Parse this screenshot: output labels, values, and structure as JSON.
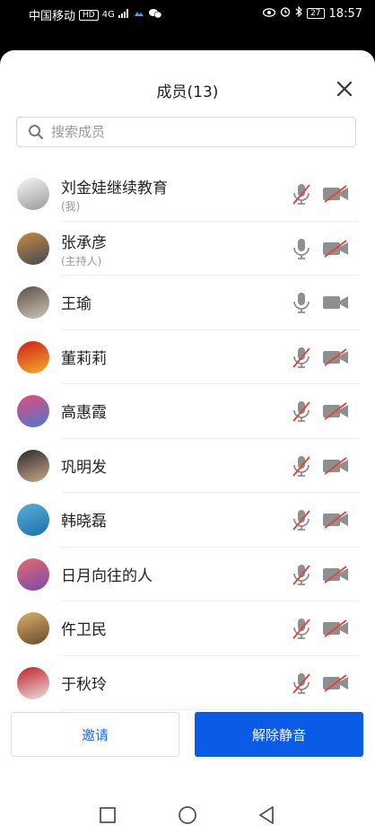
{
  "statusbar": {
    "carrier": "中国移动",
    "hd": "HD",
    "net": "4G",
    "battery": "27",
    "time": "18:57"
  },
  "dialog": {
    "title": "成员(13)",
    "search_placeholder": "搜索成员"
  },
  "members": [
    {
      "name": "刘金娃继续教育",
      "sub": "(我)",
      "mic_muted": true,
      "cam_off": true,
      "avatar": [
        "#f6f6f6",
        "#9a9a9a"
      ]
    },
    {
      "name": "张承彦",
      "sub": "(主持人)",
      "mic_muted": false,
      "cam_off": true,
      "avatar": [
        "#c98a3a",
        "#3d4a5a"
      ]
    },
    {
      "name": "王瑜",
      "sub": "",
      "mic_muted": false,
      "cam_off": false,
      "avatar": [
        "#5a5048",
        "#cfc5b8"
      ]
    },
    {
      "name": "董莉莉",
      "sub": "",
      "mic_muted": true,
      "cam_off": true,
      "avatar": [
        "#d21a1a",
        "#f3b02a"
      ]
    },
    {
      "name": "高惠霞",
      "sub": "",
      "mic_muted": true,
      "cam_off": true,
      "avatar": [
        "#e64a7a",
        "#4a7ad0"
      ]
    },
    {
      "name": "巩明发",
      "sub": "",
      "mic_muted": true,
      "cam_off": true,
      "avatar": [
        "#2a2a2a",
        "#c9a98a"
      ]
    },
    {
      "name": "韩晓磊",
      "sub": "",
      "mic_muted": true,
      "cam_off": true,
      "avatar": [
        "#58b0d8",
        "#1d6fa8"
      ]
    },
    {
      "name": "日月向往的人",
      "sub": "",
      "mic_muted": true,
      "cam_off": true,
      "avatar": [
        "#e56a6a",
        "#7a4ab0"
      ]
    },
    {
      "name": "仵卫民",
      "sub": "",
      "mic_muted": true,
      "cam_off": true,
      "avatar": [
        "#d9b06a",
        "#6a4a2a"
      ]
    },
    {
      "name": "于秋玲",
      "sub": "",
      "mic_muted": true,
      "cam_off": true,
      "avatar": [
        "#c21e2e",
        "#e9e0d8"
      ]
    }
  ],
  "actions": {
    "invite": "邀请",
    "unmute_all": "解除静音"
  },
  "colors": {
    "accent": "#0a5ce6",
    "mute_slash": "#e0463c",
    "icon_gray": "#8f8f8f"
  }
}
